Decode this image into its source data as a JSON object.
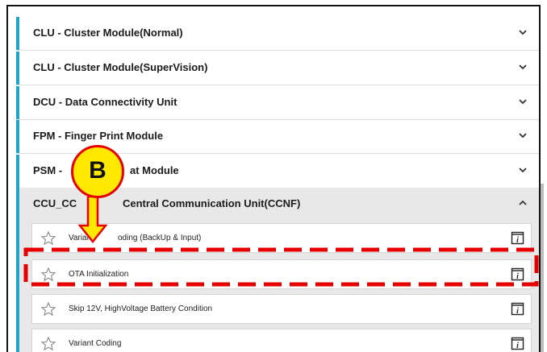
{
  "modules": [
    {
      "label": "CLU - Cluster Module(Normal)",
      "state": "collapsed"
    },
    {
      "label": "CLU - Cluster Module(SuperVision)",
      "state": "collapsed"
    },
    {
      "label": "DCU - Data Connectivity Unit",
      "state": "collapsed"
    },
    {
      "label": "FPM - Finger Print Module",
      "state": "collapsed"
    },
    {
      "label": "PSM -",
      "label_tail": "at Module",
      "state": "collapsed"
    },
    {
      "label": "CCU_CC",
      "label_tail": "Central Communication Unit(CCNF)",
      "state": "expanded"
    }
  ],
  "sub_items": [
    {
      "label_head": "Varian",
      "label_tail": "oding (BackUp & Input)"
    },
    {
      "label": "OTA Initialization",
      "highlighted": true
    },
    {
      "label": "Skip 12V, HighVoltage Battery Condition"
    },
    {
      "label": "Variant Coding"
    }
  ],
  "annotation": {
    "callout_letter": "B"
  },
  "colors": {
    "accent": "#1ea5c9",
    "callout_fill": "#ffe800",
    "callout_border": "#e60000",
    "highlight_dash": "#e60000"
  },
  "icons": {
    "collapsed": "chevron-down-icon",
    "expanded": "chevron-up-icon",
    "favorite": "star-outline-icon",
    "info": "info-icon"
  }
}
